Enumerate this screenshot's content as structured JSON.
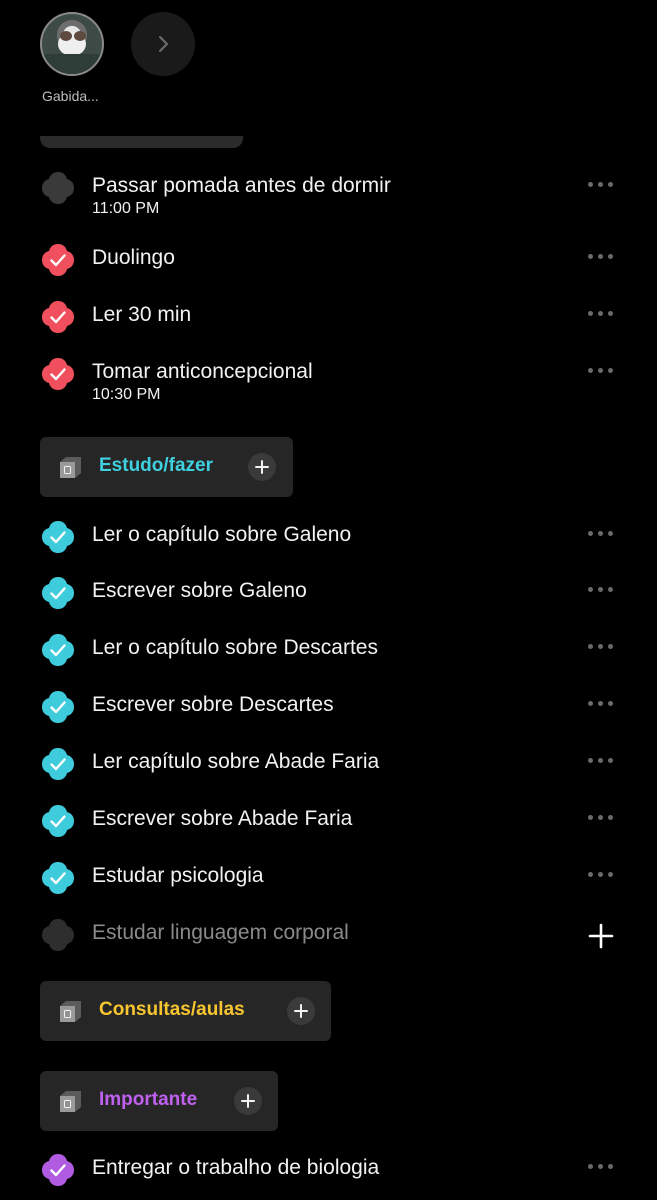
{
  "profile": {
    "name": "Gabida..."
  },
  "colors": {
    "red": "#f0505d",
    "cyan": "#3ecbdc",
    "gray": "#3a3a3a",
    "purple": "#b05be0",
    "cyan_title": "#3fd0e0",
    "yellow_title": "#f7c52f",
    "purple_title": "#c060f0"
  },
  "tasks_top": [
    {
      "title": "Passar pomada antes de dormir",
      "time": "11:00 PM",
      "done": false
    },
    {
      "title": "Duolingo",
      "done": true
    },
    {
      "title": "Ler 30 min",
      "done": true
    },
    {
      "title": "Tomar anticoncepcional",
      "time": "10:30 PM",
      "done": true
    }
  ],
  "sections": [
    {
      "title": "Estudo/fazer",
      "color": "cyan"
    },
    {
      "title": "Consultas/aulas",
      "color": "yellow"
    },
    {
      "title": "Importante",
      "color": "purple"
    }
  ],
  "tasks_estudo": [
    {
      "title": "Ler o capítulo sobre Galeno",
      "done": true
    },
    {
      "title": "Escrever sobre Galeno",
      "done": true
    },
    {
      "title": "Ler o capítulo sobre Descartes",
      "done": true
    },
    {
      "title": "Escrever sobre Descartes",
      "done": true
    },
    {
      "title": "Ler capítulo sobre Abade Faria",
      "done": true
    },
    {
      "title": "Escrever sobre Abade Faria",
      "done": true
    },
    {
      "title": "Estudar psicologia",
      "done": true
    }
  ],
  "new_task_placeholder": "Estudar linguagem corporal",
  "tasks_importante": [
    {
      "title": "Entregar o trabalho de biologia",
      "done": true
    }
  ]
}
